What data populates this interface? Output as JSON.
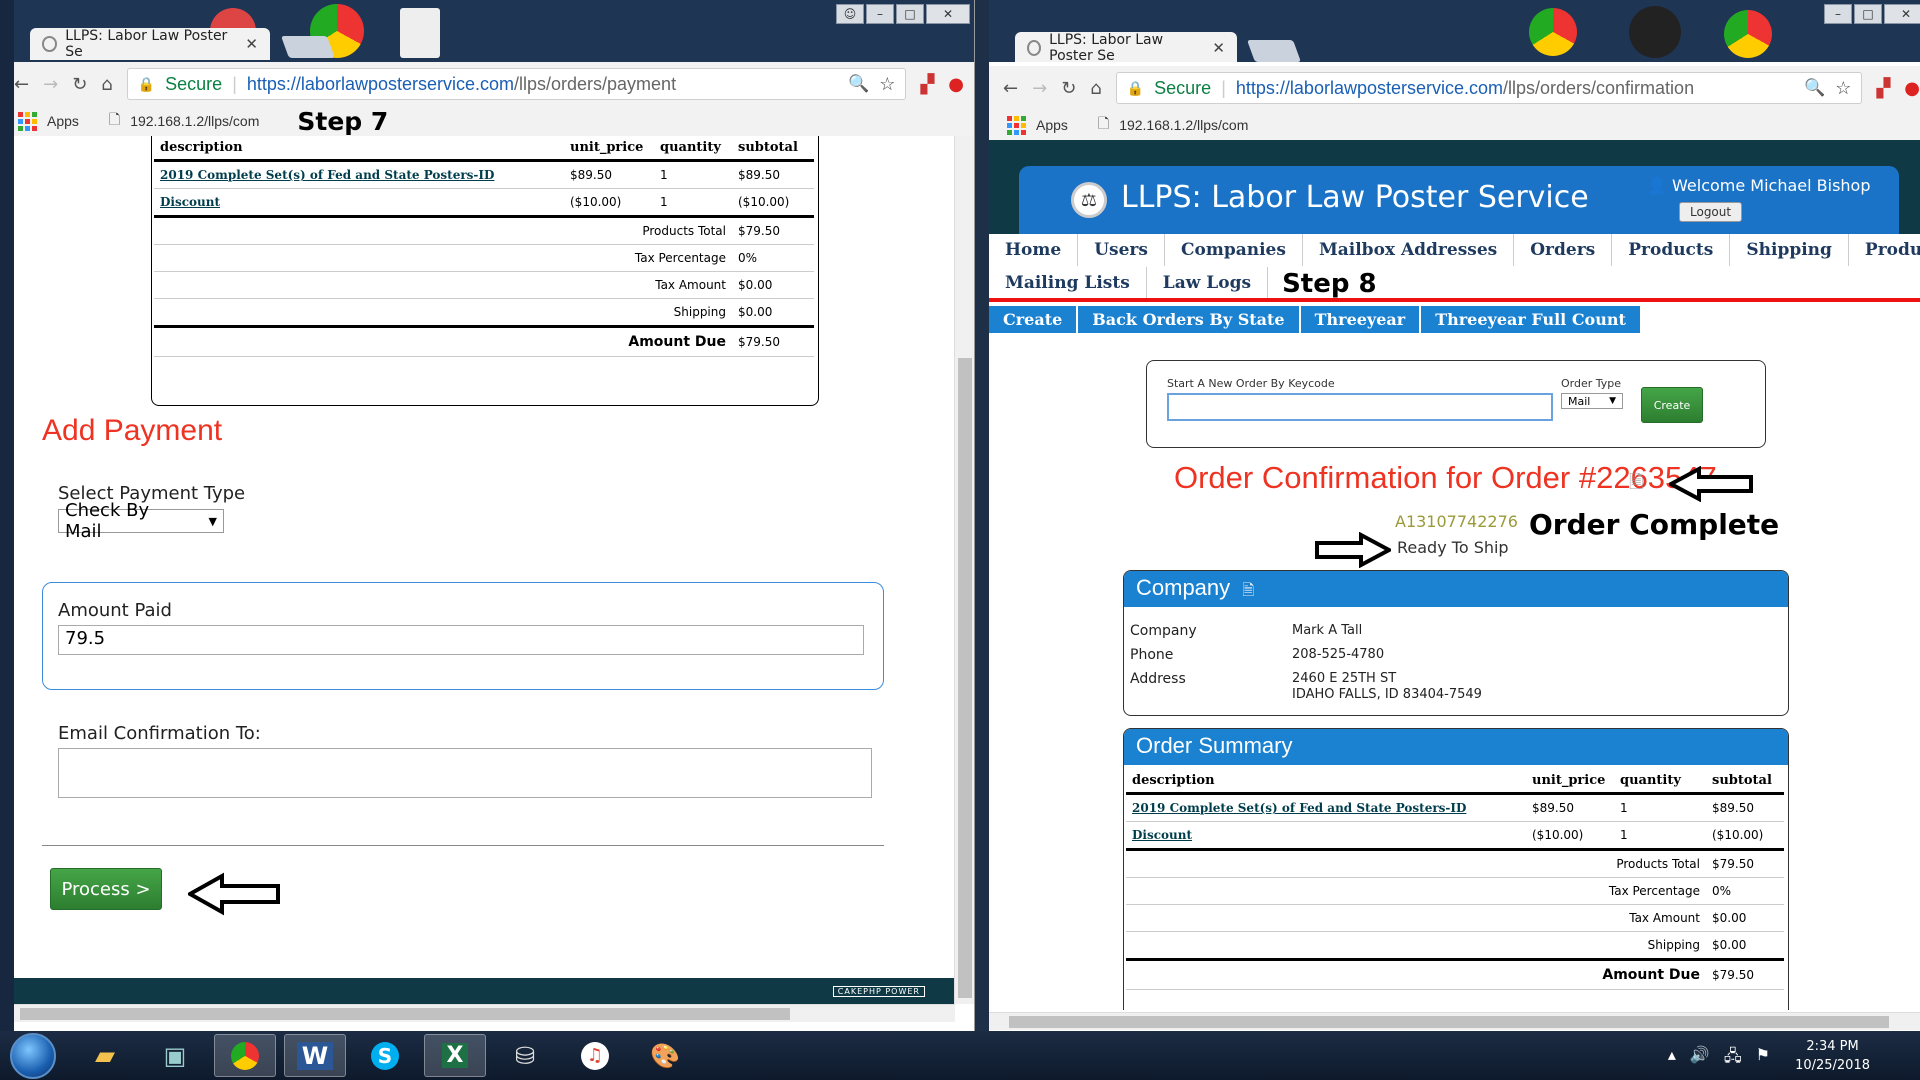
{
  "left_window": {
    "tab_title": "LLPS: Labor Law Poster Se",
    "omnibox": {
      "secure": "Secure",
      "url_host": "https://laborlawposterservice.com",
      "url_path": "/llps/orders/payment"
    },
    "bookmarks": {
      "apps": "Apps",
      "bookmark1": "192.168.1.2/llps/com"
    },
    "step_label": "Step 7",
    "order_table": {
      "headers": [
        "description",
        "unit_price",
        "quantity",
        "subtotal"
      ],
      "rows": [
        {
          "description": "2019 Complete Set(s) of Fed and State Posters-ID",
          "unit_price": "$89.50",
          "quantity": "1",
          "subtotal": "$89.50"
        },
        {
          "description": "Discount",
          "unit_price": "($10.00)",
          "quantity": "1",
          "subtotal": "($10.00)"
        }
      ],
      "totals": [
        {
          "label": "Products Total",
          "value": "$79.50"
        },
        {
          "label": "Tax Percentage",
          "value": "0%"
        },
        {
          "label": "Tax Amount",
          "value": "$0.00"
        },
        {
          "label": "Shipping",
          "value": "$0.00"
        }
      ],
      "amount_due": {
        "label": "Amount Due",
        "value": "$79.50"
      }
    },
    "add_payment": {
      "heading": "Add Payment",
      "payment_type_label": "Select Payment Type",
      "payment_type_value": "Check By Mail",
      "amount_paid_label": "Amount Paid",
      "amount_paid_value": "79.5",
      "email_label": "Email Confirmation To:",
      "email_value": "",
      "process_button": "Process >"
    },
    "footer_badge": "CAKEPHP  POWER"
  },
  "right_window": {
    "tab_title": "LLPS: Labor Law Poster Se",
    "omnibox": {
      "secure": "Secure",
      "url_host": "https://laborlawposterservice.com",
      "url_path": "/llps/orders/confirmation"
    },
    "bookmarks": {
      "apps": "Apps",
      "bookmark1": "192.168.1.2/llps/com"
    },
    "header": {
      "title": "LLPS: Labor Law Poster Service",
      "welcome": "Welcome Michael Bishop",
      "logout": "Logout"
    },
    "main_nav": [
      "Home",
      "Users",
      "Companies",
      "Mailbox Addresses",
      "Orders",
      "Products",
      "Shipping",
      "Product"
    ],
    "main_nav_row2": [
      "Mailing Lists",
      "Law Logs"
    ],
    "step_label": "Step 8",
    "sub_nav": [
      "Create",
      "Back Orders By State",
      "Threeyear",
      "Threeyear Full Count"
    ],
    "new_order": {
      "keycode_label": "Start A New Order By Keycode",
      "keycode_value": "",
      "order_type_label": "Order Type",
      "order_type_value": "Mail",
      "create_button": "Create"
    },
    "confirmation": {
      "title": "Order Confirmation for Order #2263547",
      "keycode": "A13107742276",
      "status": "Ready To Ship",
      "complete_label": "Order Complete"
    },
    "company": {
      "heading": "Company",
      "fields": [
        {
          "label": "Company",
          "value": "Mark A Tall"
        },
        {
          "label": "Phone",
          "value": "208-525-4780"
        },
        {
          "label": "Address",
          "value": "2460 E 25TH ST",
          "value2": "IDAHO FALLS, ID 83404-7549"
        }
      ]
    },
    "order_summary": {
      "heading": "Order Summary",
      "headers": [
        "description",
        "unit_price",
        "quantity",
        "subtotal"
      ],
      "rows": [
        {
          "description": "2019 Complete Set(s) of Fed and State Posters-ID",
          "unit_price": "$89.50",
          "quantity": "1",
          "subtotal": "$89.50"
        },
        {
          "description": "Discount",
          "unit_price": "($10.00)",
          "quantity": "1",
          "subtotal": "($10.00)"
        }
      ],
      "totals": [
        {
          "label": "Products Total",
          "value": "$79.50"
        },
        {
          "label": "Tax Percentage",
          "value": "0%"
        },
        {
          "label": "Tax Amount",
          "value": "$0.00"
        },
        {
          "label": "Shipping",
          "value": "$0.00"
        }
      ],
      "amount_due": {
        "label": "Amount Due",
        "value": "$79.50"
      }
    }
  },
  "taskbar": {
    "time": "2:34 PM",
    "date": "10/25/2018",
    "apps": [
      "explorer-icon",
      "window-icon",
      "chrome-icon",
      "word-icon",
      "skype-icon",
      "excel-icon",
      "database-icon",
      "itunes-icon",
      "paint-icon"
    ]
  },
  "colors": {
    "brand_blue": "#1a73c7",
    "accent_red": "#e32",
    "process_green": "#2d7e30",
    "nav_bar_blue": "#1a82d1"
  }
}
